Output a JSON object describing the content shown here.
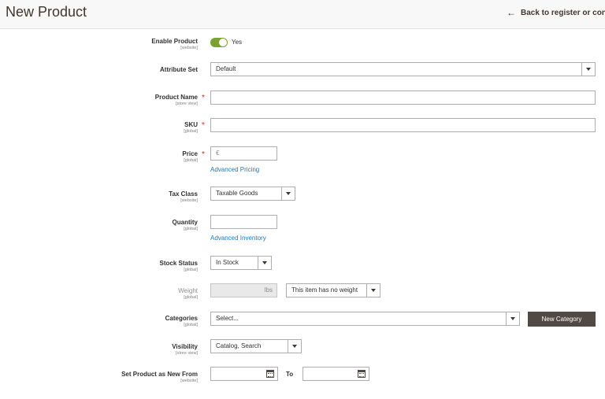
{
  "header": {
    "title": "New Product",
    "back_label": "Back to register or conn",
    "back_icon": "arrow-left-icon"
  },
  "fields": {
    "enable_product": {
      "label": "Enable Product",
      "scope": "[website]",
      "value": "Yes",
      "enabled": true
    },
    "attribute_set": {
      "label": "Attribute Set",
      "value": "Default"
    },
    "product_name": {
      "label": "Product Name",
      "scope": "[store view]",
      "required": "*",
      "value": ""
    },
    "sku": {
      "label": "SKU",
      "scope": "[global]",
      "required": "*",
      "value": ""
    },
    "price": {
      "label": "Price",
      "scope": "[global]",
      "required": "*",
      "currency": "€",
      "link": "Advanced Pricing"
    },
    "tax_class": {
      "label": "Tax Class",
      "scope": "[website]",
      "value": "Taxable Goods"
    },
    "quantity": {
      "label": "Quantity",
      "scope": "[global]",
      "value": "",
      "link": "Advanced Inventory"
    },
    "stock_status": {
      "label": "Stock Status",
      "scope": "[global]",
      "value": "In Stock"
    },
    "weight": {
      "label": "Weight",
      "scope": "[global]",
      "unit": "lbs",
      "option": "This item has no weight"
    },
    "categories": {
      "label": "Categories",
      "scope": "[global]",
      "placeholder": "Select...",
      "button": "New Category"
    },
    "visibility": {
      "label": "Visibility",
      "scope": "[store view]",
      "value": "Catalog, Search"
    },
    "new_from": {
      "label": "Set Product as New From",
      "scope": "[website]",
      "to_label": "To"
    }
  },
  "colors": {
    "toggle_on": "#79a22e",
    "link": "#1979c3",
    "required": "#e22626",
    "button_dark": "#514943"
  }
}
